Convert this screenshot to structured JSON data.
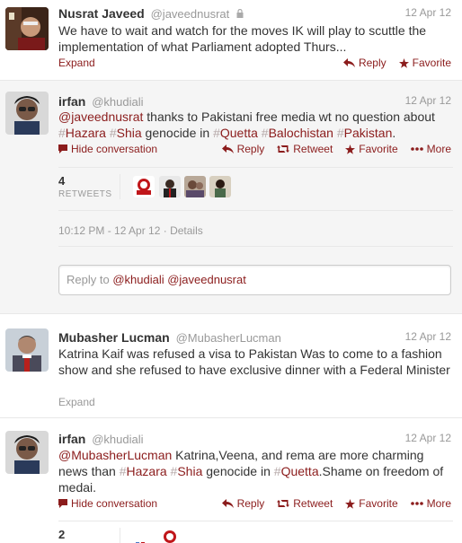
{
  "tweets": [
    {
      "fullname": "Nusrat Javeed",
      "username": "@javeednusrat",
      "time": "12 Apr 12",
      "text": "We have to wait and watch for the moves IK will play to scuttle the implementation of what Parliament adopted Thurs...",
      "expand": "Expand",
      "actions": {
        "reply": "Reply",
        "favorite": "Favorite"
      }
    },
    {
      "fullname": "irfan",
      "username": "@khudiali",
      "time": "12 Apr 12",
      "mention": "@javeednusrat",
      "text_a": " thanks to Pakistani free media wt no question about ",
      "tags": [
        "Hazara",
        "Shia",
        "Quetta",
        "Balochistan",
        "Pakistan"
      ],
      "text_b": " genocide in ",
      "hide": "Hide conversation",
      "actions": {
        "reply": "Reply",
        "retweet": "Retweet",
        "favorite": "Favorite",
        "more": "More"
      },
      "retweet_count": "4",
      "retweet_label": "RETWEETS",
      "meta": "10:12 PM - 12 Apr 12 · Details",
      "reply_prefix": "Reply to ",
      "reply_mentions": "@khudiali @javeednusrat"
    },
    {
      "fullname": "Mubasher Lucman",
      "username": "@MubasherLucman",
      "time": "12 Apr 12",
      "text": "Katrina Kaif was refused a visa to Pakistan Was to come to a fashion show and she refused to have exclusive dinner with a Federal Minister",
      "expand": "Expand"
    },
    {
      "fullname": "irfan",
      "username": "@khudiali",
      "time": "12 Apr 12",
      "mention": "@MubasherLucman",
      "text_a": " Katrina,Veena, and rema are more charming news than ",
      "tags": [
        "Hazara",
        "Shia",
        "Quetta"
      ],
      "text_b": " genocide in ",
      "text_c": ".Shame on freedom of medai.",
      "hide": "Hide conversation",
      "actions": {
        "reply": "Reply",
        "retweet": "Retweet",
        "favorite": "Favorite",
        "more": "More"
      },
      "retweet_count": "2"
    }
  ],
  "colors": {
    "link": "#8b1c1c",
    "muted": "#999999",
    "text": "#333333"
  }
}
